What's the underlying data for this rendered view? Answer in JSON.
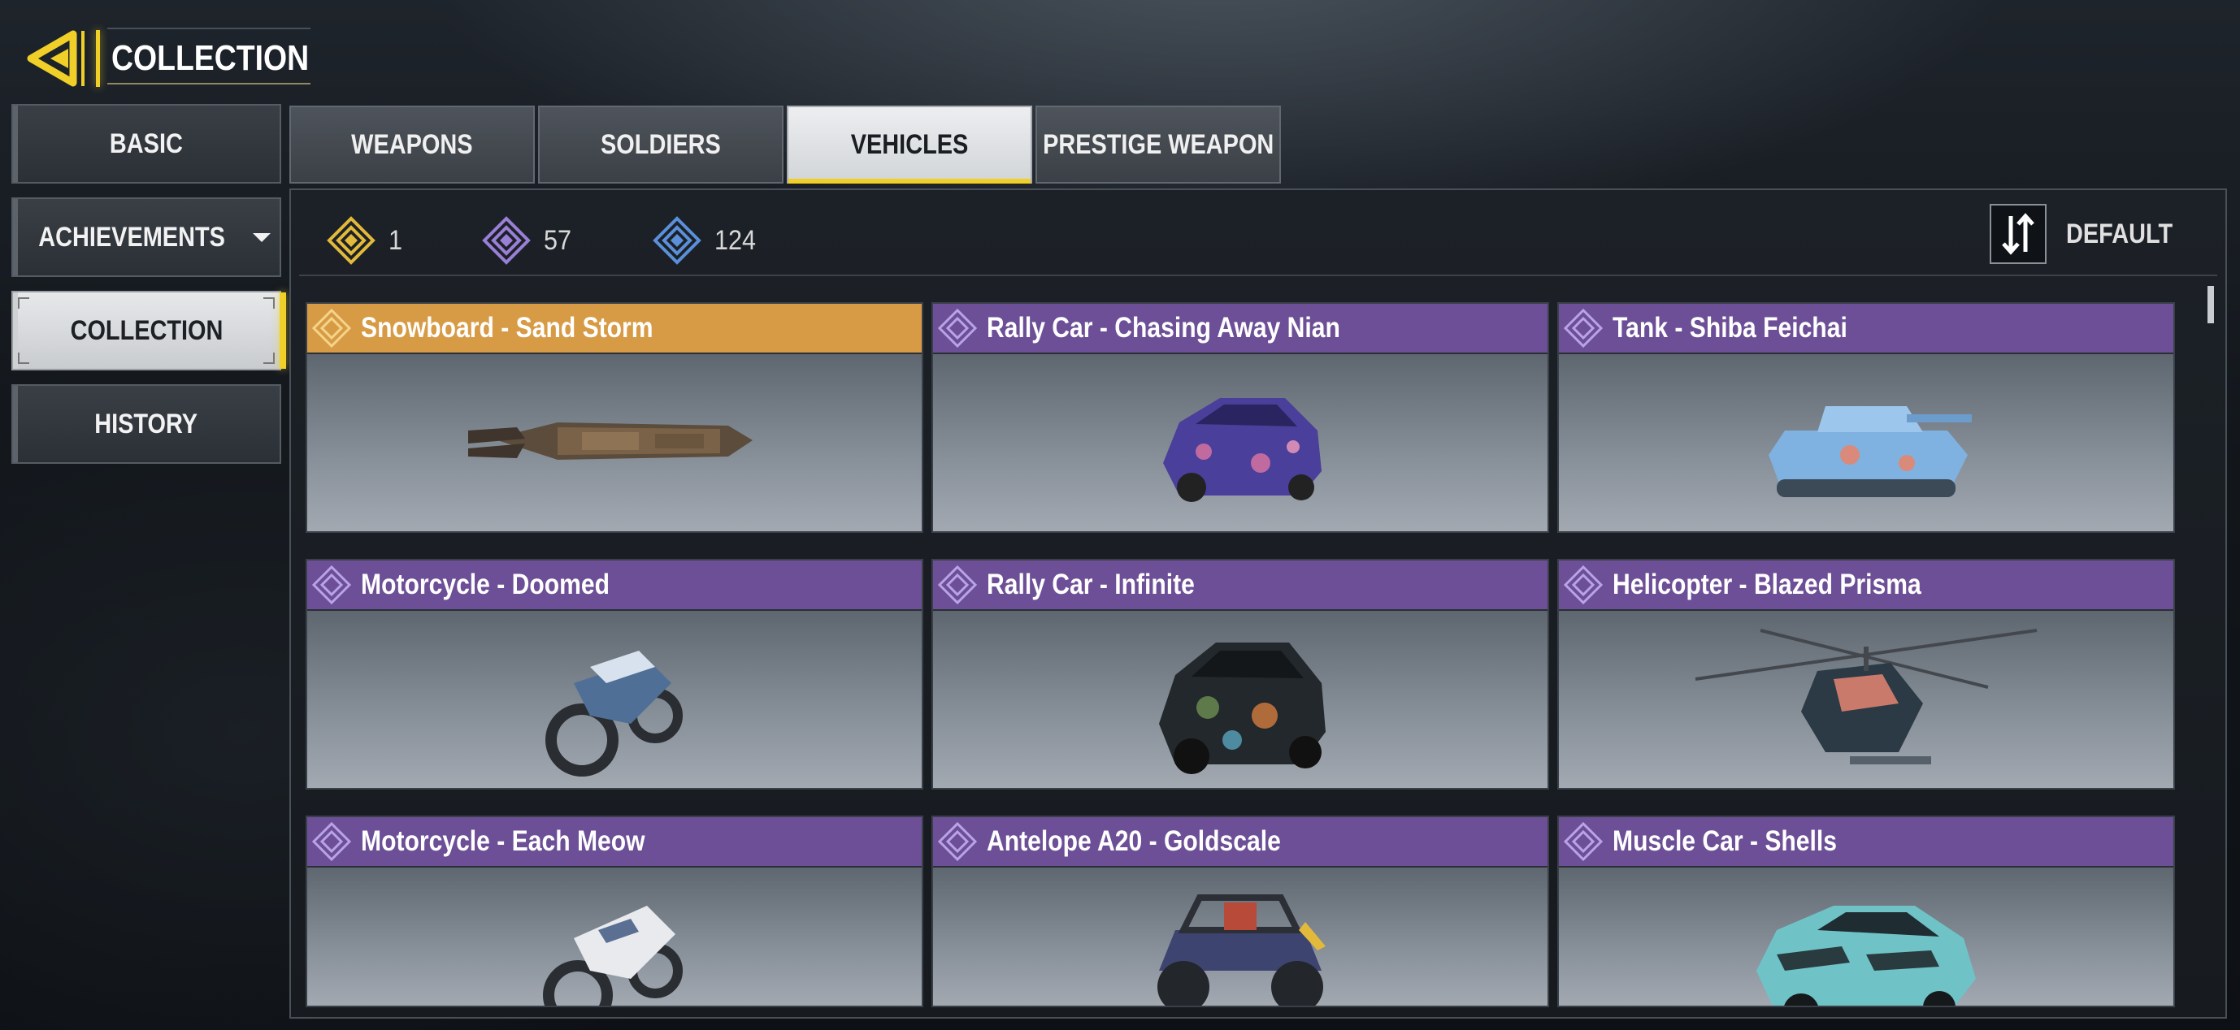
{
  "header": {
    "title": "COLLECTION",
    "back_icon": "back-arrow-icon"
  },
  "sidebar": {
    "items": [
      {
        "label": "BASIC",
        "active": false
      },
      {
        "label": "ACHIEVEMENTS",
        "active": false,
        "has_dropdown": true
      },
      {
        "label": "COLLECTION",
        "active": true
      },
      {
        "label": "HISTORY",
        "active": false
      }
    ]
  },
  "tabs": [
    {
      "label": "WEAPONS",
      "active": false
    },
    {
      "label": "SOLDIERS",
      "active": false
    },
    {
      "label": "VEHICLES",
      "active": true
    },
    {
      "label": "PRESTIGE WEAPON",
      "active": false
    }
  ],
  "currencies": [
    {
      "icon": "gold-diamond-icon",
      "value": "1",
      "color": "#e2b93b"
    },
    {
      "icon": "purple-diamond-icon",
      "value": "57",
      "color": "#9a7fd6"
    },
    {
      "icon": "blue-diamond-icon",
      "value": "124",
      "color": "#5a8fd9"
    }
  ],
  "sort": {
    "label": "DEFAULT",
    "icon": "sort-icon"
  },
  "items": [
    {
      "name": "Snowboard - Sand Storm",
      "rarity": "gold",
      "vehicle": "snowboard"
    },
    {
      "name": "Rally Car - Chasing Away Nian",
      "rarity": "purple",
      "vehicle": "car"
    },
    {
      "name": "Tank - Shiba Feichai",
      "rarity": "purple",
      "vehicle": "tank"
    },
    {
      "name": "Motorcycle - Doomed",
      "rarity": "purple",
      "vehicle": "motorcycle"
    },
    {
      "name": "Rally Car - Infinite",
      "rarity": "purple",
      "vehicle": "car"
    },
    {
      "name": "Helicopter - Blazed Prisma",
      "rarity": "purple",
      "vehicle": "helicopter"
    },
    {
      "name": "Motorcycle - Each Meow",
      "rarity": "purple",
      "vehicle": "motorcycle"
    },
    {
      "name": "Antelope A20 - Goldscale",
      "rarity": "purple",
      "vehicle": "buggy"
    },
    {
      "name": "Muscle Car - Shells",
      "rarity": "purple",
      "vehicle": "musclecar"
    }
  ],
  "colors": {
    "accent": "#f0d028",
    "purple_rarity": "#6c4f96",
    "gold_rarity": "#d89b45"
  }
}
